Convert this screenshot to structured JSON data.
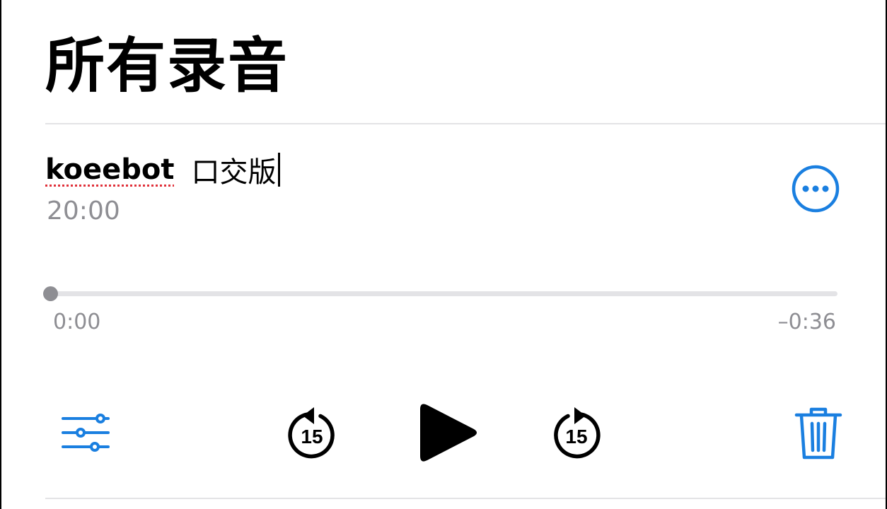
{
  "header": {
    "title": "所有录音"
  },
  "recording": {
    "name_part1": "koeebot",
    "name_part2": "口交版",
    "date": "20:00",
    "progress": 0,
    "time_elapsed": "0:00",
    "time_remaining": "–0:36"
  },
  "controls": {
    "options_icon": "sliders-icon",
    "skip_back_label": "15",
    "play_icon": "play-icon",
    "skip_forward_label": "15",
    "trash_icon": "trash-icon",
    "more_icon": "ellipsis-circle-icon"
  },
  "colors": {
    "accent": "#1a7fe0",
    "secondary_text": "#8e8e93",
    "spellcheck_underline": "#e0303a"
  }
}
